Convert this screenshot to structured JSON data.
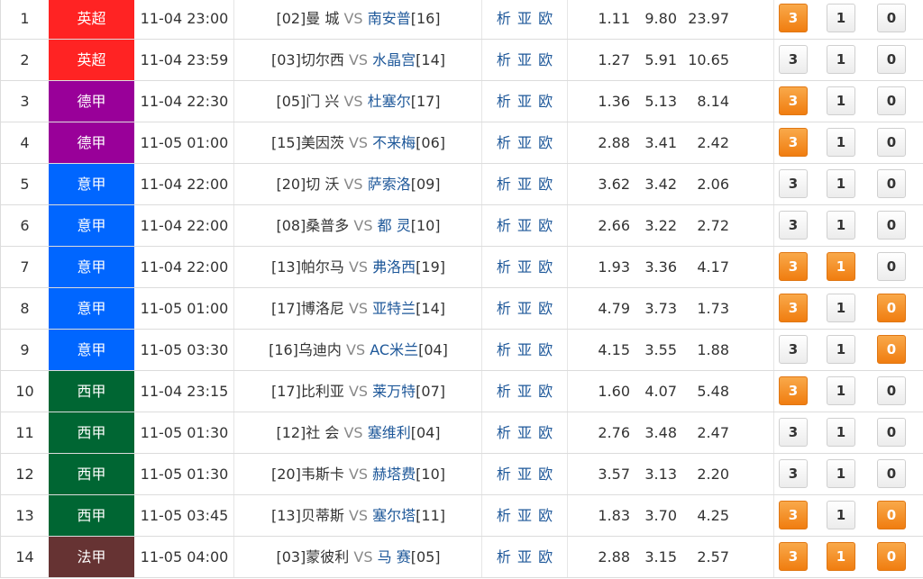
{
  "colors": {
    "premier": "#ff2323",
    "bundesliga": "#990099",
    "seriea": "#0066ff",
    "laliga": "#006633",
    "ligue1": "#663333",
    "selected_bet": "#f58a1f",
    "link_blue": "#1d5799"
  },
  "links": [
    "析",
    "亚",
    "欧"
  ],
  "bet_labels": [
    "3",
    "1",
    "0"
  ],
  "matches": [
    {
      "no": "1",
      "league": "英超",
      "color": "#ff2323",
      "time": "11-04 23:00",
      "home_rank": "[02]",
      "home": "曼 城",
      "vs": "VS",
      "away": "南安普",
      "away_rank": "[16]",
      "odds": [
        "1.11",
        "9.80",
        "23.97"
      ],
      "picks": [
        true,
        false,
        false
      ]
    },
    {
      "no": "2",
      "league": "英超",
      "color": "#ff2323",
      "time": "11-04 23:59",
      "home_rank": "[03]",
      "home": "切尔西",
      "vs": "VS",
      "away": "水晶宫",
      "away_rank": "[14]",
      "odds": [
        "1.27",
        "5.91",
        "10.65"
      ],
      "picks": [
        false,
        false,
        false
      ]
    },
    {
      "no": "3",
      "league": "德甲",
      "color": "#990099",
      "time": "11-04 22:30",
      "home_rank": "[05]",
      "home": "门 兴",
      "vs": "VS",
      "away": "杜塞尔",
      "away_rank": "[17]",
      "odds": [
        "1.36",
        "5.13",
        "8.14"
      ],
      "picks": [
        true,
        false,
        false
      ]
    },
    {
      "no": "4",
      "league": "德甲",
      "color": "#990099",
      "time": "11-05 01:00",
      "home_rank": "[15]",
      "home": "美因茨",
      "vs": "VS",
      "away": "不来梅",
      "away_rank": "[06]",
      "odds": [
        "2.88",
        "3.41",
        "2.42"
      ],
      "picks": [
        true,
        false,
        false
      ]
    },
    {
      "no": "5",
      "league": "意甲",
      "color": "#0066ff",
      "time": "11-04 22:00",
      "home_rank": "[20]",
      "home": "切 沃",
      "vs": "VS",
      "away": "萨索洛",
      "away_rank": "[09]",
      "odds": [
        "3.62",
        "3.42",
        "2.06"
      ],
      "picks": [
        false,
        false,
        false
      ]
    },
    {
      "no": "6",
      "league": "意甲",
      "color": "#0066ff",
      "time": "11-04 22:00",
      "home_rank": "[08]",
      "home": "桑普多",
      "vs": "VS",
      "away": "都 灵",
      "away_rank": "[10]",
      "odds": [
        "2.66",
        "3.22",
        "2.72"
      ],
      "picks": [
        false,
        false,
        false
      ]
    },
    {
      "no": "7",
      "league": "意甲",
      "color": "#0066ff",
      "time": "11-04 22:00",
      "home_rank": "[13]",
      "home": "帕尔马",
      "vs": "VS",
      "away": "弗洛西",
      "away_rank": "[19]",
      "odds": [
        "1.93",
        "3.36",
        "4.17"
      ],
      "picks": [
        true,
        true,
        false
      ]
    },
    {
      "no": "8",
      "league": "意甲",
      "color": "#0066ff",
      "time": "11-05 01:00",
      "home_rank": "[17]",
      "home": "博洛尼",
      "vs": "VS",
      "away": "亚特兰",
      "away_rank": "[14]",
      "odds": [
        "4.79",
        "3.73",
        "1.73"
      ],
      "picks": [
        true,
        false,
        true
      ]
    },
    {
      "no": "9",
      "league": "意甲",
      "color": "#0066ff",
      "time": "11-05 03:30",
      "home_rank": "[16]",
      "home": "乌迪内",
      "vs": "VS",
      "away": "AC米兰",
      "away_rank": "[04]",
      "odds": [
        "4.15",
        "3.55",
        "1.88"
      ],
      "picks": [
        false,
        false,
        true
      ]
    },
    {
      "no": "10",
      "league": "西甲",
      "color": "#006633",
      "time": "11-04 23:15",
      "home_rank": "[17]",
      "home": "比利亚",
      "vs": "VS",
      "away": "莱万特",
      "away_rank": "[07]",
      "odds": [
        "1.60",
        "4.07",
        "5.48"
      ],
      "picks": [
        true,
        false,
        false
      ]
    },
    {
      "no": "11",
      "league": "西甲",
      "color": "#006633",
      "time": "11-05 01:30",
      "home_rank": "[12]",
      "home": "社 会",
      "vs": "VS",
      "away": "塞维利",
      "away_rank": "[04]",
      "odds": [
        "2.76",
        "3.48",
        "2.47"
      ],
      "picks": [
        false,
        false,
        false
      ]
    },
    {
      "no": "12",
      "league": "西甲",
      "color": "#006633",
      "time": "11-05 01:30",
      "home_rank": "[20]",
      "home": "韦斯卡",
      "vs": "VS",
      "away": "赫塔费",
      "away_rank": "[10]",
      "odds": [
        "3.57",
        "3.13",
        "2.20"
      ],
      "picks": [
        false,
        false,
        false
      ]
    },
    {
      "no": "13",
      "league": "西甲",
      "color": "#006633",
      "time": "11-05 03:45",
      "home_rank": "[13]",
      "home": "贝蒂斯",
      "vs": "VS",
      "away": "塞尔塔",
      "away_rank": "[11]",
      "odds": [
        "1.83",
        "3.70",
        "4.25"
      ],
      "picks": [
        true,
        false,
        true
      ]
    },
    {
      "no": "14",
      "league": "法甲",
      "color": "#663333",
      "time": "11-05 04:00",
      "home_rank": "[03]",
      "home": "蒙彼利",
      "vs": "VS",
      "away": "马 赛",
      "away_rank": "[05]",
      "odds": [
        "2.88",
        "3.15",
        "2.57"
      ],
      "picks": [
        true,
        true,
        true
      ]
    }
  ]
}
